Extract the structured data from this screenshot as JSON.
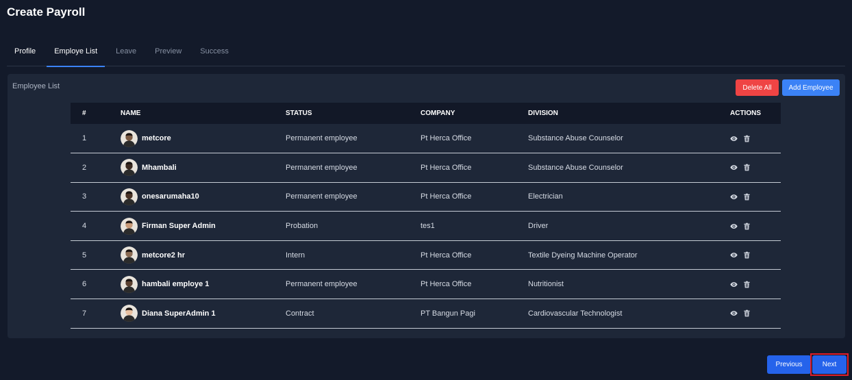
{
  "page": {
    "title": "Create Payroll"
  },
  "tabs": [
    {
      "label": "Profile"
    },
    {
      "label": "Employe List"
    },
    {
      "label": "Leave"
    },
    {
      "label": "Preview"
    },
    {
      "label": "Success"
    }
  ],
  "card": {
    "title": "Employee List",
    "delete_all_label": "Delete All",
    "add_employee_label": "Add Employee"
  },
  "table": {
    "headers": [
      "#",
      "NAME",
      "STATUS",
      "COMPANY",
      "DIVISION",
      "ACTIONS"
    ],
    "rows": [
      {
        "num": "1",
        "name": "metcore",
        "status": "Permanent employee",
        "company": "Pt Herca Office",
        "division": "Substance Abuse Counselor"
      },
      {
        "num": "2",
        "name": "Mhambali",
        "status": "Permanent employee",
        "company": "Pt Herca Office",
        "division": "Substance Abuse Counselor"
      },
      {
        "num": "3",
        "name": "onesarumaha10",
        "status": "Permanent employee",
        "company": "Pt Herca Office",
        "division": "Electrician"
      },
      {
        "num": "4",
        "name": "Firman Super Admin",
        "status": "Probation",
        "company": "tes1",
        "division": "Driver"
      },
      {
        "num": "5",
        "name": "metcore2 hr",
        "status": "Intern",
        "company": "Pt Herca Office",
        "division": "Textile Dyeing Machine Operator"
      },
      {
        "num": "6",
        "name": "hambali employe 1",
        "status": "Permanent employee",
        "company": "Pt Herca Office",
        "division": "Nutritionist"
      },
      {
        "num": "7",
        "name": "Diana SuperAdmin 1",
        "status": "Contract",
        "company": "PT Bangun Pagi",
        "division": "Cardiovascular Technologist"
      }
    ],
    "action_icons": [
      "eye-icon",
      "trash-icon"
    ]
  },
  "footer": {
    "previous_label": "Previous",
    "next_label": "Next"
  },
  "colors": {
    "background": "#131a2a",
    "card": "#1e2738",
    "accent": "#3b82f6",
    "danger": "#ef4444",
    "highlight": "#e11d2a"
  }
}
